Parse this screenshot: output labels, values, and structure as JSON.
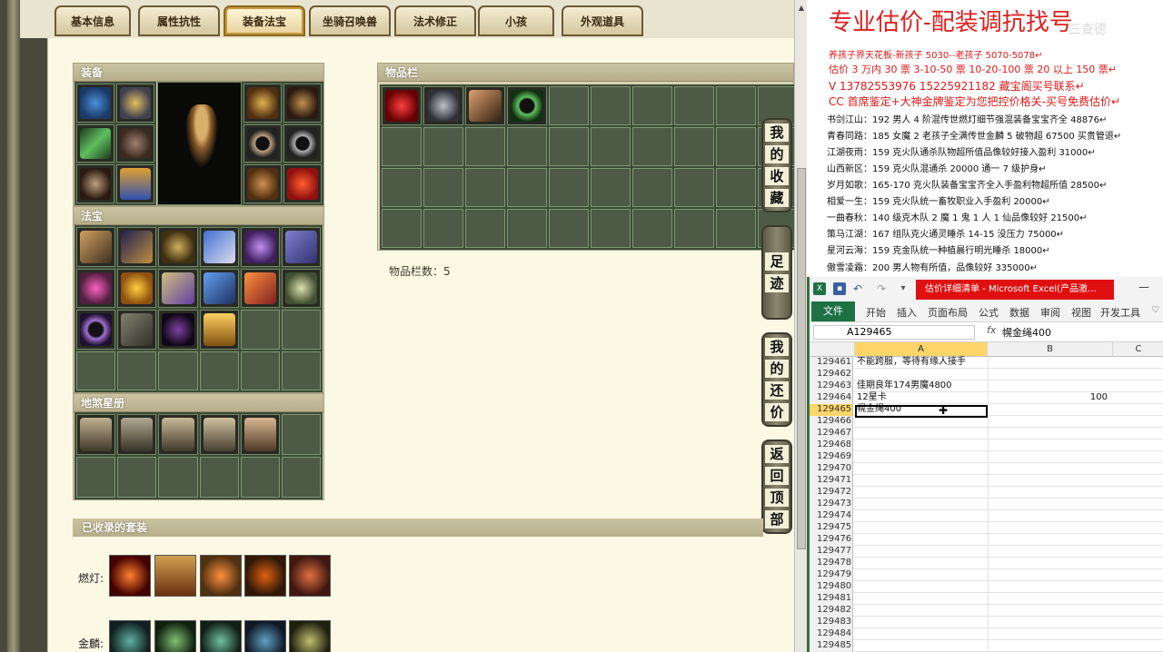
{
  "tabs": [
    {
      "label": "基本信息"
    },
    {
      "label": "属性抗性"
    },
    {
      "label": "装备法宝"
    },
    {
      "label": "坐骑召唤兽"
    },
    {
      "label": "法术修正"
    },
    {
      "label": "小孩"
    },
    {
      "label": "外观道具"
    }
  ],
  "equipment": {
    "title": "装备"
  },
  "treasure": {
    "title": "法宝"
  },
  "stars": {
    "title": "地煞星册"
  },
  "inventory": {
    "title": "物品栏",
    "count_label": "物品栏数：5"
  },
  "side_buttons": {
    "favorite": [
      "我",
      "的",
      "收",
      "藏"
    ],
    "footprint": [
      "足",
      "迹"
    ],
    "counter_offer": [
      "我",
      "的",
      "还",
      "价"
    ],
    "back_top": [
      "返",
      "回",
      "顶",
      "部"
    ]
  },
  "suits": {
    "title": "已收录的套装",
    "rows": [
      {
        "label": "燃灯:"
      },
      {
        "label": "金麟:"
      }
    ]
  },
  "ad": {
    "title": "专业估价-配装调抗找号",
    "watermark": "三查德",
    "red_lines": [
      "养孩子界天花板-新孩子 5030--老孩子 5070-5078↵",
      "估价 3 万内 30 票   3-10-50 票   10-20-100 票   20 以上 150 票↵",
      "V 13782553976     15225921182   藏宝阁买号联系↵",
      "CC 首席鉴定+大神金牌鉴定为您把控价格关-买号免费估价↵"
    ],
    "lines": [
      "书剑江山：192 男人 4 阶混传世燃灯细节强混装备宝宝齐全 48876↵",
      "青春同路：185 女魔 2 老孩子全满传世金麟 5 破物超 67500 买贵管退↵",
      "江湖夜雨：159 克火队通杀队物超所值品像较好接入盈利 31000↵",
      "山西新区：159 克火队混通杀 20000 通一 7 级护身↵",
      "岁月如歌：165-170 克火队装备宝宝齐全入手盈利物超所值 28500↵",
      "相爱一生：159 克火队统一畜牧职业入手盈利 20000↵",
      "一曲春秋：140 级克木队 2 魔 1 鬼 1 人 1 仙品像较好 21500↵",
      "策马江湖：167 组队克火通灵睡杀 14-15 没压力 75000↵",
      "星河云海：159 克金队统一种植晨行明光睡杀 18000↵",
      "傲雪凌霜：200 男人物有所值，品像较好 335000↵"
    ]
  },
  "excel": {
    "caption": "估价详细清单 - Microsoft Excel(产品激...",
    "file_tab": "文件",
    "menu": [
      "开始",
      "插入",
      "页面布局",
      "公式",
      "数据",
      "审阅",
      "视图",
      "开发工具"
    ],
    "namebox": "A129465",
    "fx": "fx",
    "formula": "幌金绳400",
    "columns": [
      "A",
      "B",
      "C"
    ],
    "rows": [
      {
        "num": "129461",
        "a": "不能跨服，等待有缘人接手",
        "b": ""
      },
      {
        "num": "129462",
        "a": "",
        "b": ""
      },
      {
        "num": "129463",
        "a": "佳期良年174男魔4800",
        "b": ""
      },
      {
        "num": "129464",
        "a": "12星卡",
        "b": "100"
      },
      {
        "num": "129465",
        "a": "幌金绳400",
        "b": ""
      },
      {
        "num": "129466",
        "a": "",
        "b": ""
      },
      {
        "num": "129467",
        "a": "",
        "b": ""
      },
      {
        "num": "129468",
        "a": "",
        "b": ""
      },
      {
        "num": "129469",
        "a": "",
        "b": ""
      },
      {
        "num": "129470",
        "a": "",
        "b": ""
      },
      {
        "num": "129471",
        "a": "",
        "b": ""
      },
      {
        "num": "129472",
        "a": "",
        "b": ""
      },
      {
        "num": "129473",
        "a": "",
        "b": ""
      },
      {
        "num": "129474",
        "a": "",
        "b": ""
      },
      {
        "num": "129475",
        "a": "",
        "b": ""
      },
      {
        "num": "129476",
        "a": "",
        "b": ""
      },
      {
        "num": "129477",
        "a": "",
        "b": ""
      },
      {
        "num": "129478",
        "a": "",
        "b": ""
      },
      {
        "num": "129479",
        "a": "",
        "b": ""
      },
      {
        "num": "129480",
        "a": "",
        "b": ""
      },
      {
        "num": "129481",
        "a": "",
        "b": ""
      },
      {
        "num": "129482",
        "a": "",
        "b": ""
      },
      {
        "num": "129483",
        "a": "",
        "b": ""
      },
      {
        "num": "129484",
        "a": "",
        "b": ""
      },
      {
        "num": "129485",
        "a": "",
        "b": ""
      }
    ]
  },
  "colors": {
    "accent_red": "#e02020",
    "excel_green": "#1e7145",
    "selection": "#ffd569"
  }
}
